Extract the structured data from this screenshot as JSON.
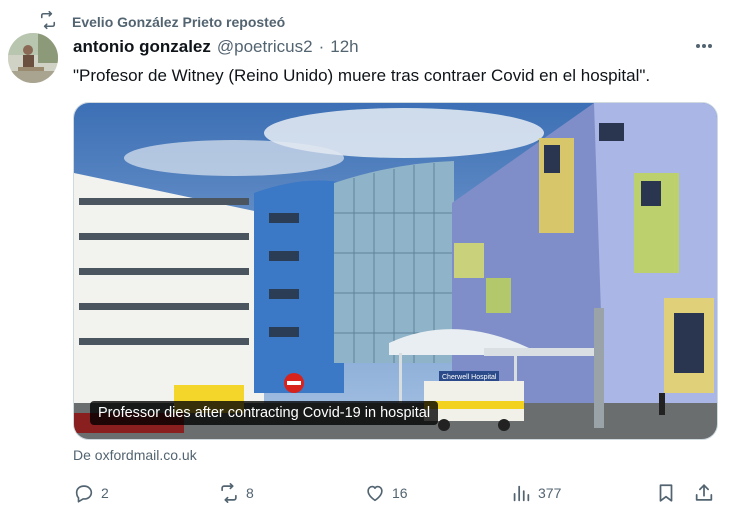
{
  "repost": {
    "text": "Evelio González Prieto reposteó",
    "icon": "repost-icon"
  },
  "tweet": {
    "author_name": "antonio gonzalez",
    "author_handle": "@poetricus2",
    "separator": "·",
    "time": "12h",
    "text": "\"Profesor de Witney (Reino Unido) muere tras contraer Covid en el hospital\"."
  },
  "card": {
    "caption": "Professor dies after contracting Covid-19 in hospital",
    "source": "De oxfordmail.co.uk",
    "sign_text": "Cherwell Hospital"
  },
  "actions": {
    "replies": "2",
    "reposts": "8",
    "likes": "16",
    "views": "377"
  },
  "colors": {
    "muted": "#536471",
    "text": "#0f1419",
    "border": "#cfd9de"
  }
}
